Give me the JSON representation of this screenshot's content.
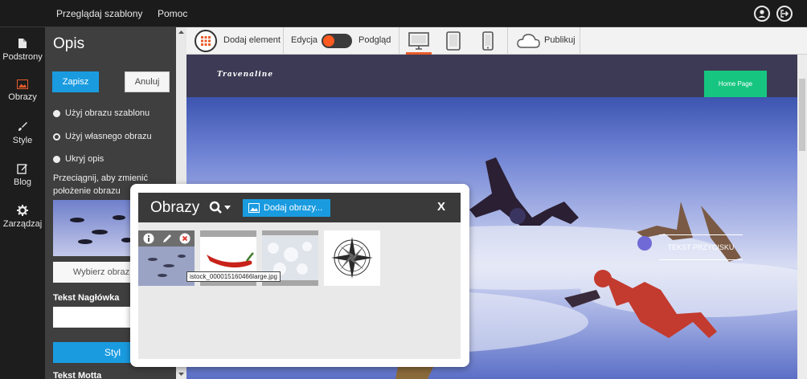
{
  "topbar": {
    "browse_templates": "Przeglądaj szablony",
    "help": "Pomoc",
    "icons": [
      "user-icon",
      "logout-icon"
    ]
  },
  "rail": {
    "items": [
      {
        "label": "Podstrony",
        "icon": "page-icon"
      },
      {
        "label": "Obrazy",
        "icon": "image-icon",
        "active": true,
        "active_color": "#e85b2a"
      },
      {
        "label": "Style",
        "icon": "brush-icon"
      },
      {
        "label": "Blog",
        "icon": "edit-icon"
      },
      {
        "label": "Zarządzaj",
        "icon": "gear-icon"
      }
    ]
  },
  "panel": {
    "title": "Opis",
    "save_label": "Zapisz",
    "cancel_label": "Anuluj",
    "radio_template": "Użyj obrazu szablonu",
    "radio_own": "Użyj własnego obrazu",
    "radio_hide": "Ukryj opis",
    "drag_hint": "Przeciągnij, aby zmienić położenie obrazu",
    "select_image": "Wybierz obraz",
    "header_text_label": "Tekst Nagłówka",
    "header_text_value": "",
    "style_label": "Styl",
    "motto_label": "Tekst Motta"
  },
  "toolbar": {
    "add_element": "Dodaj element",
    "edit_mode": "Edycja",
    "preview_mode": "Podgląd",
    "publish": "Publikuj",
    "devices": [
      "desktop-icon",
      "tablet-icon",
      "phone-icon"
    ],
    "active_device": "desktop-icon",
    "accent": "#e85b2a"
  },
  "site": {
    "brand": "Travenaline",
    "nav_button": "Home Page",
    "hero_button": "TEKST PRZYCISKU"
  },
  "dialog": {
    "title": "Obrazy",
    "add_images": "Dodaj obrazy...",
    "close": "X",
    "images": [
      "skydivers",
      "chili-pepper",
      "white-texture",
      "compass-rose"
    ],
    "tooltip": "istock_000015160466large.jpg"
  },
  "colors": {
    "primary_button": "#1a9be0",
    "nav_button": "#16c680",
    "site_header": "#3d3a55"
  }
}
